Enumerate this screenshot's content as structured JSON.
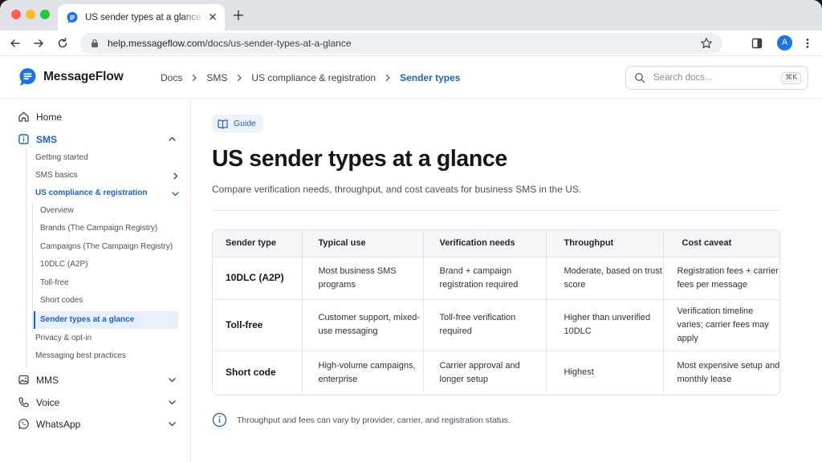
{
  "browser": {
    "tab_title": "US sender types at a glance | MessageFlow",
    "url_host": "help.messageflow.com",
    "url_path": "/docs/us-sender-types-at-a-glance",
    "avatar_letter": "A"
  },
  "site": {
    "brand": "MessageFlow",
    "breadcrumb": [
      "Docs",
      "SMS",
      "US compliance & registration",
      "Sender types"
    ],
    "search_placeholder": "Search docs...",
    "search_shortcut": "⌘K"
  },
  "sidebar": {
    "home": "Home",
    "sms": "SMS",
    "sms_children": {
      "getting_started": "Getting started",
      "sms_basics": "SMS basics",
      "us_compliance": "US compliance & registration",
      "compliance_children": [
        "Overview",
        "Brands (The Campaign Registry)",
        "Campaigns (The Campaign Registry)",
        "10DLC (A2P)",
        "Toll-free",
        "Short codes",
        "Sender types at a glance"
      ],
      "privacy": "Privacy & opt-in",
      "best_practices": "Messaging best practices"
    },
    "mms": "MMS",
    "voice": "Voice",
    "whatsapp": "WhatsApp"
  },
  "main": {
    "badge": "Guide",
    "title": "US sender types at a glance",
    "subtitle": "Compare verification needs, throughput, and cost caveats for business SMS in the US.",
    "table": {
      "headers": [
        "Sender type",
        "Typical use",
        "Verification needs",
        "Throughput",
        "Cost caveat"
      ],
      "rows": [
        [
          "10DLC (A2P)",
          "Most business SMS programs",
          "Brand + campaign registration required",
          "Moderate, based on trust score",
          "Registration fees + carrier fees per message"
        ],
        [
          "Toll-free",
          "Customer support, mixed-use messaging",
          "Toll-free verification required",
          "Higher than unverified 10DLC",
          "Verification timeline varies; carrier fees may apply"
        ],
        [
          "Short code",
          "High-volume campaigns, enterprise",
          "Carrier approval and longer setup",
          "Highest",
          "Most expensive setup and monthly lease"
        ]
      ]
    },
    "note": "Throughput and fees can vary by provider, carrier, and registration status."
  },
  "colors": {
    "accent": "#1a5fd6",
    "brand": "#1a73e8"
  }
}
